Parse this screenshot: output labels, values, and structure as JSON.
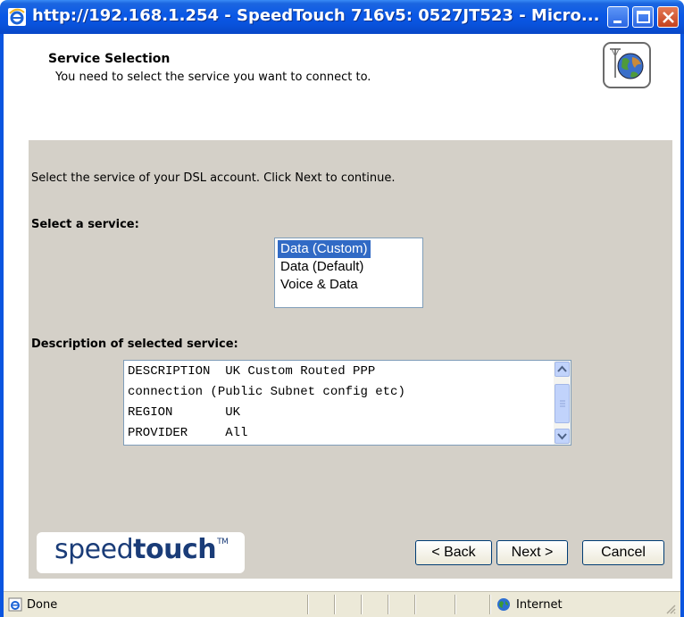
{
  "window": {
    "title": "http://192.168.1.254 - SpeedTouch 716v5: 0527JT523 - Micro...",
    "controls": [
      "minimize",
      "maximize",
      "close"
    ]
  },
  "header": {
    "title": "Service Selection",
    "subtitle": "You need to select the service you want to connect to.",
    "icon": "globe-network-icon"
  },
  "main": {
    "instruction": "Select the service of your DSL account. Click Next to continue.",
    "select_label": "Select a service:",
    "services": [
      "Data (Custom)",
      "Data (Default)",
      "Voice & Data"
    ],
    "selected_service": "Data (Custom)",
    "description_label": "Description of selected service:",
    "description_lines": [
      "DESCRIPTION  UK Custom Routed PPP",
      "connection (Public Subnet config etc)",
      "REGION       UK",
      "PROVIDER     All"
    ]
  },
  "footer": {
    "logo_light": "speed",
    "logo_bold": "touch",
    "logo_tm": "TM",
    "back_label": "< Back",
    "next_label": "Next >",
    "cancel_label": "Cancel"
  },
  "statusbar": {
    "status": "Done",
    "zone": "Internet"
  },
  "colors": {
    "titlebar": "#0a58e6",
    "panel": "#d4d0c8",
    "selection": "#316ac5",
    "logo": "#1a3c78"
  }
}
